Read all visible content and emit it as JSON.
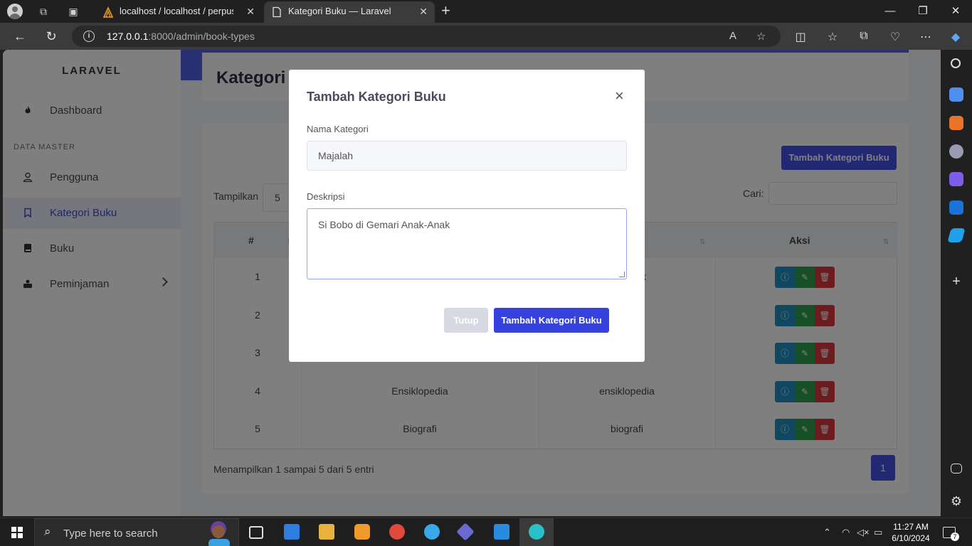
{
  "browser": {
    "tabs": [
      {
        "label": "localhost / localhost / perpus_we",
        "active": false
      },
      {
        "label": "Kategori Buku — Laravel",
        "active": true
      }
    ],
    "url_host": "127.0.0.1",
    "url_rest": ":8000/admin/book-types"
  },
  "app": {
    "brand": "LARAVEL",
    "sidebar": {
      "dashboard": "Dashboard",
      "section_header": "DATA MASTER",
      "items": [
        "Pengguna",
        "Kategori Buku",
        "Buku",
        "Peminjaman"
      ],
      "active_item": "Kategori Buku"
    },
    "page_title": "Kategori",
    "add_button": "Tambah Kategori Buku",
    "show_label": "Tampilkan",
    "show_value": "5",
    "search_label": "Cari:",
    "table": {
      "headers": [
        "#",
        "",
        "",
        "Aksi"
      ],
      "rows": [
        {
          "no": "1",
          "name": "",
          "desc": "k"
        },
        {
          "no": "2",
          "name": "",
          "desc": ""
        },
        {
          "no": "3",
          "name": "",
          "desc": ""
        },
        {
          "no": "4",
          "name": "Ensiklopedia",
          "desc": "ensiklopedia"
        },
        {
          "no": "5",
          "name": "Biografi",
          "desc": "biografi"
        }
      ]
    },
    "info_text": "Menampilkan 1 sampai 5 dari 5 entri",
    "page_number": "1"
  },
  "modal": {
    "title": "Tambah Kategori Buku",
    "close_symbol": "×",
    "name_label": "Nama Kategori",
    "name_value": "Majalah",
    "desc_label": "Deskripsi",
    "desc_value": "Si Bobo di Gemari Anak-Anak",
    "close_button": "Tutup",
    "submit_button": "Tambah Kategori Buku"
  },
  "taskbar": {
    "search_placeholder": "Type here to search",
    "time": "11:27 AM",
    "date": "6/10/2024",
    "notification_count": "7"
  },
  "colors": {
    "primary": "#4650e6",
    "info": "#2390c2",
    "success": "#2f9f4e",
    "danger": "#d8363e"
  },
  "icons": {
    "tab_favicon_1": "phpmyadmin-icon",
    "tab_favicon_2": "page-icon",
    "dashboard": "fire-icon",
    "pengguna": "user-icon",
    "kategori": "bookmark-icon",
    "buku": "book-icon",
    "peminjaman": "briefcase-icon"
  }
}
